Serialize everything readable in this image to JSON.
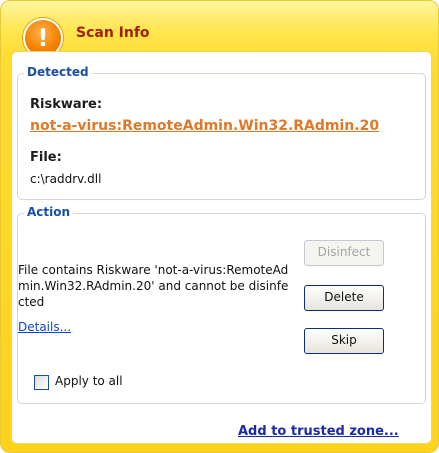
{
  "window": {
    "title": "Scan Info",
    "icon": "warning-icon",
    "icon_glyph": "!"
  },
  "detected": {
    "legend": "Detected",
    "riskware_label": "Riskware:",
    "threat_name": "not-a-virus:RemoteAdmin.Win32.RAdmin.20",
    "file_label": "File:",
    "file_path": "c:\\raddrv.dll"
  },
  "action": {
    "legend": "Action",
    "message": "File contains Riskware 'not-a-virus:RemoteAdmin.Win32.RAdmin.20' and cannot be disinfected",
    "details_link": "Details...",
    "buttons": {
      "disinfect": "Disinfect",
      "delete": "Delete",
      "skip": "Skip"
    },
    "apply_to_all_label": "Apply to all",
    "apply_to_all_checked": false
  },
  "footer": {
    "trusted_zone_link": "Add to trusted zone..."
  },
  "colors": {
    "title": "#a0210a",
    "legend": "#1a4fa8",
    "threat": "#e0782a",
    "link": "#1046c8"
  }
}
